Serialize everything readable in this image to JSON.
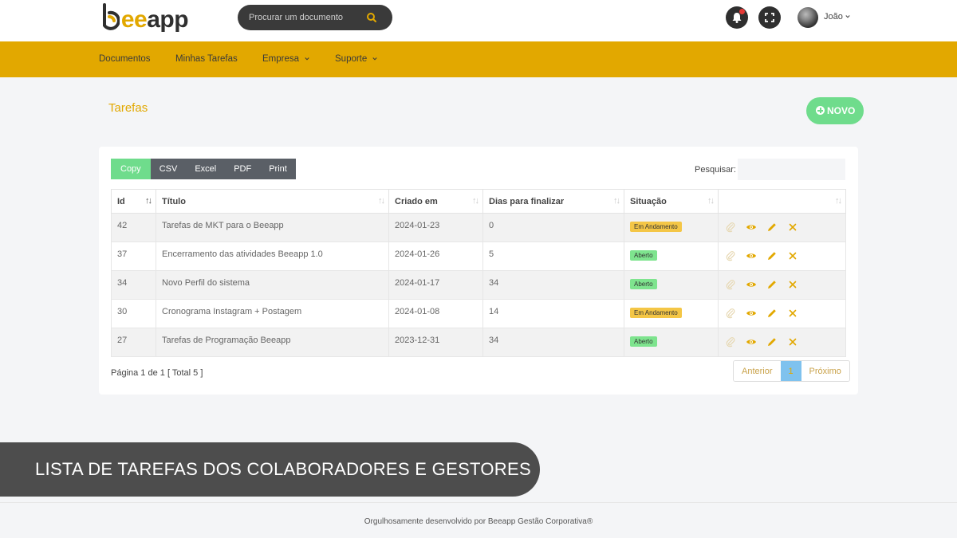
{
  "header": {
    "logo_prefix": "b",
    "logo_accent": "ee",
    "logo_suffix": "app",
    "search_placeholder": "Procurar um documento",
    "user_name": "João",
    "icons": [
      "search-icon",
      "bell-icon",
      "fullscreen-icon",
      "chevron-down-icon"
    ]
  },
  "nav": {
    "items": [
      {
        "label": "Documentos"
      },
      {
        "label": "Minhas Tarefas"
      },
      {
        "label": "Empresa",
        "dropdown": true
      },
      {
        "label": "Suporte",
        "dropdown": true
      }
    ]
  },
  "page": {
    "title": "Tarefas",
    "new_button": "NOVO"
  },
  "toolbar": {
    "buttons": [
      "Copy",
      "CSV",
      "Excel",
      "PDF",
      "Print"
    ],
    "search_label": "Pesquisar:"
  },
  "table": {
    "columns": [
      "Id",
      "Título",
      "Criado em",
      "Dias para finalizar",
      "Situação",
      ""
    ],
    "rows": [
      {
        "id": "42",
        "title": "Tarefas de MKT para o Beeapp",
        "created": "2024-01-23",
        "days": "0",
        "status": "Em Andamento",
        "status_type": "andamento"
      },
      {
        "id": "37",
        "title": "Encerramento das atividades Beeapp 1.0",
        "created": "2024-01-26",
        "days": "5",
        "status": "Aberto",
        "status_type": "aberto"
      },
      {
        "id": "34",
        "title": "Novo Perfil do sistema",
        "created": "2024-01-17",
        "days": "34",
        "status": "Aberto",
        "status_type": "aberto"
      },
      {
        "id": "30",
        "title": "Cronograma Instagram + Postagem",
        "created": "2024-01-08",
        "days": "14",
        "status": "Em Andamento",
        "status_type": "andamento"
      },
      {
        "id": "27",
        "title": "Tarefas de Programação Beeapp",
        "created": "2023-12-31",
        "days": "34",
        "status": "Aberto",
        "status_type": "aberto"
      }
    ],
    "row_action_icons": [
      "paperclip-icon",
      "eye-icon",
      "pencil-icon",
      "close-icon"
    ]
  },
  "pagination": {
    "info": "Página 1 de 1 [ Total 5 ]",
    "previous": "Anterior",
    "current": "1",
    "next": "Próximo"
  },
  "caption": "LISTA DE TAREFAS DOS COLABORADORES E GESTORES",
  "footer": "Orgulhosamente desenvolvido por Beeapp Gestão Corporativa®",
  "colors": {
    "brand_yellow": "#e2a800",
    "dark": "#2f2f2f",
    "success": "#6fdc8c",
    "badge_andamento": "#f4c646",
    "badge_aberto": "#7ee48e"
  }
}
